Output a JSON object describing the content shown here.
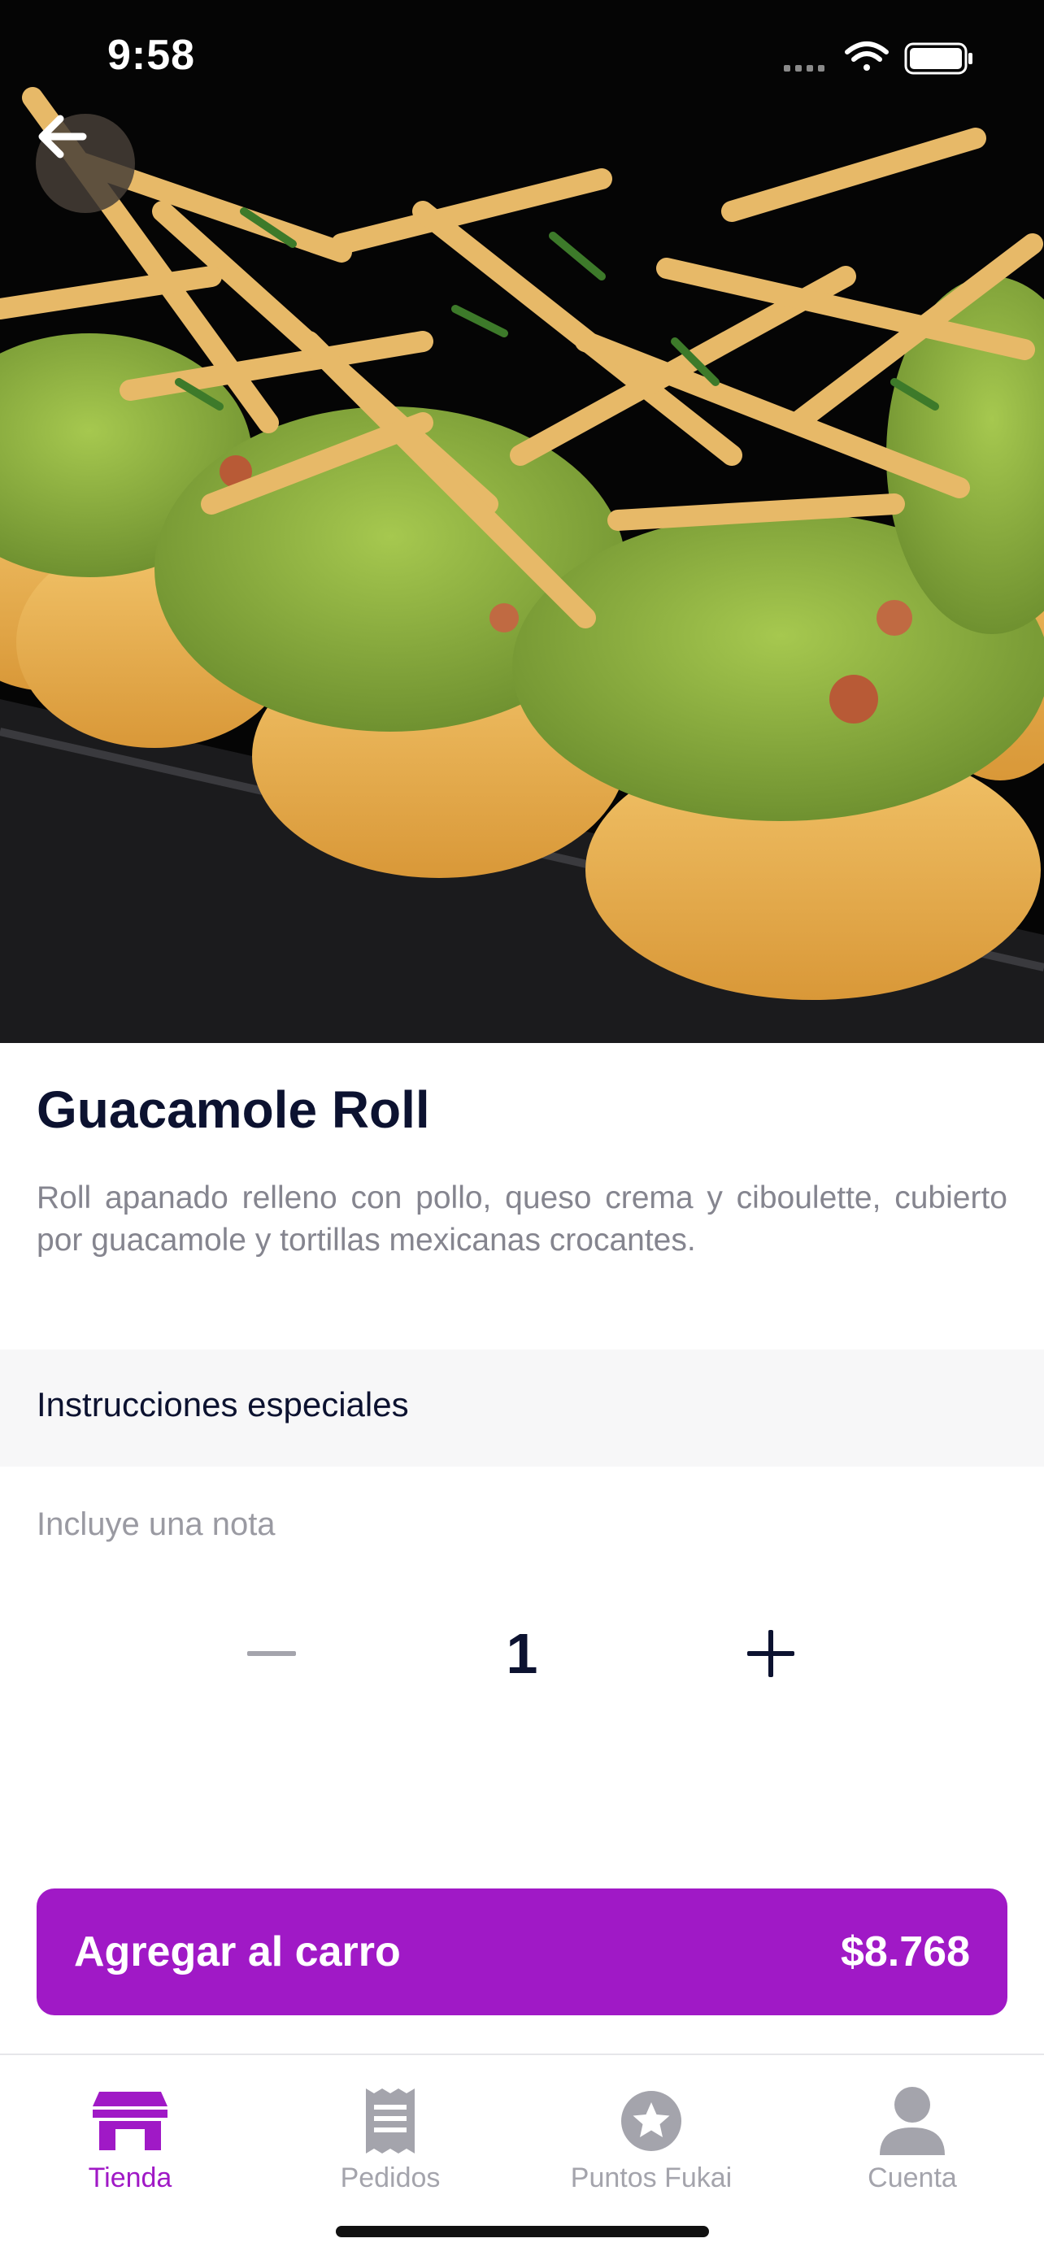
{
  "status_bar": {
    "time": "9:58"
  },
  "icons": {
    "back": "arrow-left-icon",
    "wifi": "wifi-icon",
    "battery": "battery-icon",
    "signal": "signal-icon"
  },
  "product": {
    "name": "Guacamole Roll",
    "description": "Roll apanado relleno con pollo, queso crema y ciboulette, cubierto por guacamole y tortillas mexicanas crocantes."
  },
  "special_instructions": {
    "title": "Instrucciones especiales",
    "placeholder": "Incluye una nota"
  },
  "quantity": {
    "value": "1"
  },
  "cart_button": {
    "label": "Agregar al carro",
    "price": "$8.768"
  },
  "tabs": [
    {
      "label": "Tienda",
      "icon": "store-icon",
      "active": true
    },
    {
      "label": "Pedidos",
      "icon": "receipt-icon",
      "active": false
    },
    {
      "label": "Puntos Fukai",
      "icon": "star-badge-icon",
      "active": false
    },
    {
      "label": "Cuenta",
      "icon": "user-icon",
      "active": false
    }
  ],
  "colors": {
    "accent": "#a019c6",
    "text_dark": "#0c1230",
    "text_muted": "#85858f",
    "tab_inactive": "#a4a4ac"
  }
}
